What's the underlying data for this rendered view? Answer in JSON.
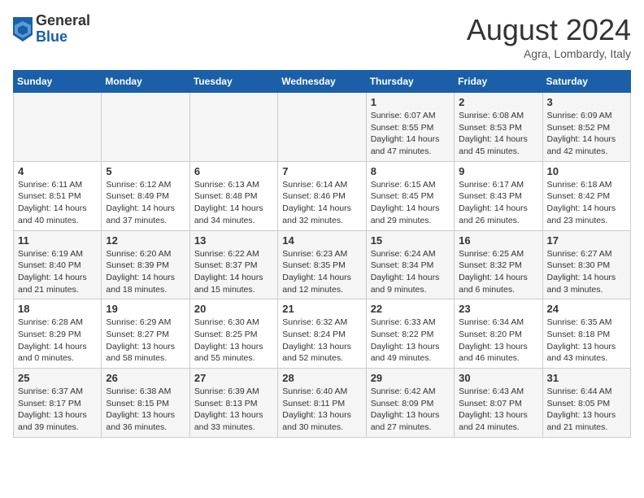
{
  "header": {
    "logo_general": "General",
    "logo_blue": "Blue",
    "month_title": "August 2024",
    "subtitle": "Agra, Lombardy, Italy"
  },
  "weekdays": [
    "Sunday",
    "Monday",
    "Tuesday",
    "Wednesday",
    "Thursday",
    "Friday",
    "Saturday"
  ],
  "weeks": [
    [
      {
        "day": "",
        "info": ""
      },
      {
        "day": "",
        "info": ""
      },
      {
        "day": "",
        "info": ""
      },
      {
        "day": "",
        "info": ""
      },
      {
        "day": "1",
        "info": "Sunrise: 6:07 AM\nSunset: 8:55 PM\nDaylight: 14 hours and 47 minutes."
      },
      {
        "day": "2",
        "info": "Sunrise: 6:08 AM\nSunset: 8:53 PM\nDaylight: 14 hours and 45 minutes."
      },
      {
        "day": "3",
        "info": "Sunrise: 6:09 AM\nSunset: 8:52 PM\nDaylight: 14 hours and 42 minutes."
      }
    ],
    [
      {
        "day": "4",
        "info": "Sunrise: 6:11 AM\nSunset: 8:51 PM\nDaylight: 14 hours and 40 minutes."
      },
      {
        "day": "5",
        "info": "Sunrise: 6:12 AM\nSunset: 8:49 PM\nDaylight: 14 hours and 37 minutes."
      },
      {
        "day": "6",
        "info": "Sunrise: 6:13 AM\nSunset: 8:48 PM\nDaylight: 14 hours and 34 minutes."
      },
      {
        "day": "7",
        "info": "Sunrise: 6:14 AM\nSunset: 8:46 PM\nDaylight: 14 hours and 32 minutes."
      },
      {
        "day": "8",
        "info": "Sunrise: 6:15 AM\nSunset: 8:45 PM\nDaylight: 14 hours and 29 minutes."
      },
      {
        "day": "9",
        "info": "Sunrise: 6:17 AM\nSunset: 8:43 PM\nDaylight: 14 hours and 26 minutes."
      },
      {
        "day": "10",
        "info": "Sunrise: 6:18 AM\nSunset: 8:42 PM\nDaylight: 14 hours and 23 minutes."
      }
    ],
    [
      {
        "day": "11",
        "info": "Sunrise: 6:19 AM\nSunset: 8:40 PM\nDaylight: 14 hours and 21 minutes."
      },
      {
        "day": "12",
        "info": "Sunrise: 6:20 AM\nSunset: 8:39 PM\nDaylight: 14 hours and 18 minutes."
      },
      {
        "day": "13",
        "info": "Sunrise: 6:22 AM\nSunset: 8:37 PM\nDaylight: 14 hours and 15 minutes."
      },
      {
        "day": "14",
        "info": "Sunrise: 6:23 AM\nSunset: 8:35 PM\nDaylight: 14 hours and 12 minutes."
      },
      {
        "day": "15",
        "info": "Sunrise: 6:24 AM\nSunset: 8:34 PM\nDaylight: 14 hours and 9 minutes."
      },
      {
        "day": "16",
        "info": "Sunrise: 6:25 AM\nSunset: 8:32 PM\nDaylight: 14 hours and 6 minutes."
      },
      {
        "day": "17",
        "info": "Sunrise: 6:27 AM\nSunset: 8:30 PM\nDaylight: 14 hours and 3 minutes."
      }
    ],
    [
      {
        "day": "18",
        "info": "Sunrise: 6:28 AM\nSunset: 8:29 PM\nDaylight: 14 hours and 0 minutes."
      },
      {
        "day": "19",
        "info": "Sunrise: 6:29 AM\nSunset: 8:27 PM\nDaylight: 13 hours and 58 minutes."
      },
      {
        "day": "20",
        "info": "Sunrise: 6:30 AM\nSunset: 8:25 PM\nDaylight: 13 hours and 55 minutes."
      },
      {
        "day": "21",
        "info": "Sunrise: 6:32 AM\nSunset: 8:24 PM\nDaylight: 13 hours and 52 minutes."
      },
      {
        "day": "22",
        "info": "Sunrise: 6:33 AM\nSunset: 8:22 PM\nDaylight: 13 hours and 49 minutes."
      },
      {
        "day": "23",
        "info": "Sunrise: 6:34 AM\nSunset: 8:20 PM\nDaylight: 13 hours and 46 minutes."
      },
      {
        "day": "24",
        "info": "Sunrise: 6:35 AM\nSunset: 8:18 PM\nDaylight: 13 hours and 43 minutes."
      }
    ],
    [
      {
        "day": "25",
        "info": "Sunrise: 6:37 AM\nSunset: 8:17 PM\nDaylight: 13 hours and 39 minutes."
      },
      {
        "day": "26",
        "info": "Sunrise: 6:38 AM\nSunset: 8:15 PM\nDaylight: 13 hours and 36 minutes."
      },
      {
        "day": "27",
        "info": "Sunrise: 6:39 AM\nSunset: 8:13 PM\nDaylight: 13 hours and 33 minutes."
      },
      {
        "day": "28",
        "info": "Sunrise: 6:40 AM\nSunset: 8:11 PM\nDaylight: 13 hours and 30 minutes."
      },
      {
        "day": "29",
        "info": "Sunrise: 6:42 AM\nSunset: 8:09 PM\nDaylight: 13 hours and 27 minutes."
      },
      {
        "day": "30",
        "info": "Sunrise: 6:43 AM\nSunset: 8:07 PM\nDaylight: 13 hours and 24 minutes."
      },
      {
        "day": "31",
        "info": "Sunrise: 6:44 AM\nSunset: 8:05 PM\nDaylight: 13 hours and 21 minutes."
      }
    ]
  ]
}
